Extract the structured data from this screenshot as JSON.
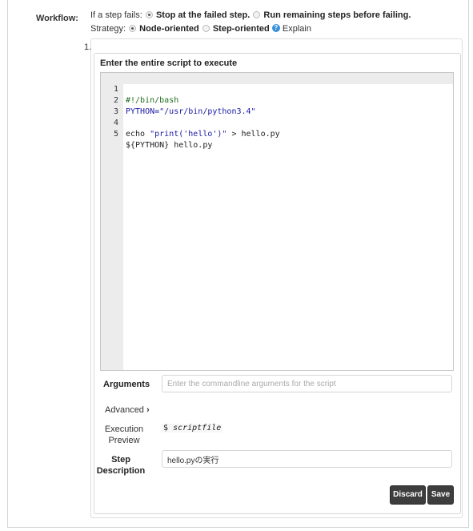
{
  "workflow": {
    "label": "Workflow:",
    "if_fails_prefix": "If a step fails:",
    "option_stop": "Stop at the failed step.",
    "option_run": "Run remaining steps before failing.",
    "strategy_prefix": "Strategy:",
    "option_node": "Node-oriented",
    "option_step": "Step-oriented",
    "explain": "Explain"
  },
  "step": {
    "number": "1.",
    "script_title": "Enter the entire script to execute",
    "code_lines": [
      {
        "n": "1",
        "text": "#!/bin/bash",
        "kind": "comment"
      },
      {
        "n": "2",
        "text": "PYTHON=\"/usr/bin/python3.4\"",
        "kind": "str"
      },
      {
        "n": "3",
        "text": "",
        "kind": "plain"
      },
      {
        "n": "4",
        "text": "echo \"print('hello')\" > hello.py",
        "kind": "mixed"
      },
      {
        "n": "5",
        "text": "${PYTHON} hello.py",
        "kind": "plain"
      }
    ],
    "arguments_label": "Arguments",
    "arguments_placeholder": "Enter the commandline arguments for the script",
    "advanced_label": "Advanced",
    "exec_preview_label1": "Execution",
    "exec_preview_label2": "Preview",
    "exec_preview_prompt": "$",
    "exec_preview_value": "scriptfile",
    "step_desc_label1": "Step",
    "step_desc_label2": "Description",
    "step_desc_value": "hello.pyの実行",
    "discard_label": "Discard",
    "save_label": "Save"
  },
  "icons": {
    "help": "question-circle-icon",
    "advanced": "chevron-right-icon"
  }
}
